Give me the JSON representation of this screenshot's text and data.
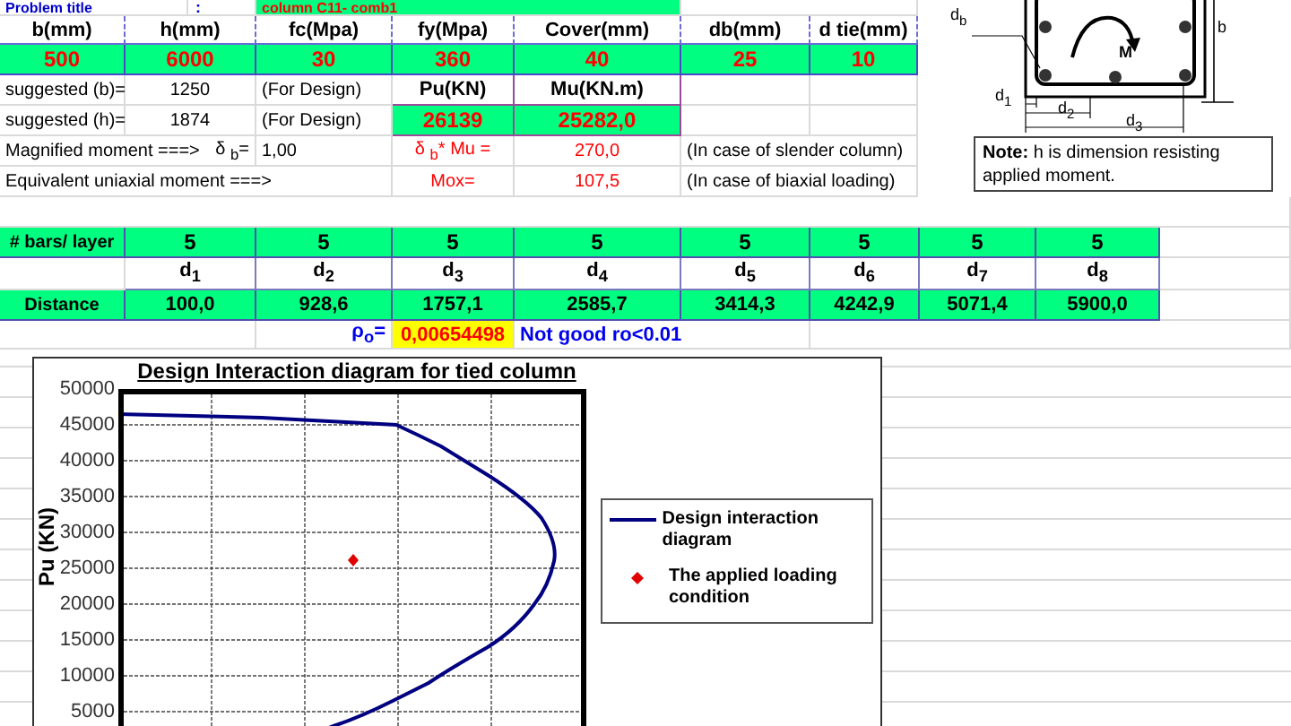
{
  "problem_title": {
    "label": "Problem title",
    "separator": ":",
    "value": "column C11- comb1"
  },
  "inputs": [
    {
      "label": "b(mm)",
      "value": "500"
    },
    {
      "label": "h(mm)",
      "value": "6000"
    },
    {
      "label": "fc(Mpa)",
      "value": "30"
    },
    {
      "label": "fy(Mpa)",
      "value": "360"
    },
    {
      "label": "Cover(mm)",
      "value": "40"
    },
    {
      "label": "db(mm)",
      "value": "25"
    },
    {
      "label": "d tie(mm)",
      "value": "10"
    }
  ],
  "suggested": [
    {
      "label": "suggested (b)=",
      "value": "1250",
      "note": "(For Design)"
    },
    {
      "label": "suggested (h)=",
      "value": "1874",
      "note": "(For Design)"
    }
  ],
  "loads": [
    {
      "label": "Pu(KN)",
      "value": "26139"
    },
    {
      "label": "Mu(KN.m)",
      "value": "25282,0"
    }
  ],
  "magnified": {
    "label": "Magnified moment ===>",
    "factor_label": "δ $_{b}$=",
    "factor": "1,00",
    "result_label": "δ $_{b}$* Mu =",
    "result": "270,0",
    "remark": "(In case of slender column)"
  },
  "equivalent": {
    "label": "Equivalent uniaxial moment ===>",
    "result_label": "Mox=",
    "result": "107,5",
    "remark": "(In case of biaxial loading)"
  },
  "section_drawing": {
    "labels": [
      "d$_{b}$",
      "b",
      "M",
      "d$_{1}$",
      "d$_{2}$",
      "d$_{3}$"
    ]
  },
  "note": "**Note:** h  is dimension resisting applied moment.",
  "layers": {
    "bars_label": "# bars/ layer",
    "distance_label": "Distance",
    "columns": [
      {
        "bars": "5",
        "name": "d$_{1}$",
        "distance": "100,0"
      },
      {
        "bars": "5",
        "name": "d$_{2}$",
        "distance": "928,6"
      },
      {
        "bars": "5",
        "name": "d$_{3}$",
        "distance": "1757,1"
      },
      {
        "bars": "5",
        "name": "d$_{4}$",
        "distance": "2585,7"
      },
      {
        "bars": "5",
        "name": "d$_{5}$",
        "distance": "3414,3"
      },
      {
        "bars": "5",
        "name": "d$_{6}$",
        "distance": "4242,9"
      },
      {
        "bars": "5",
        "name": "d$_{7}$",
        "distance": "5071,4"
      },
      {
        "bars": "5",
        "name": "d$_{8}$",
        "distance": "5900,0"
      }
    ]
  },
  "ratio": {
    "label": "ρ$_{o}$=",
    "value": "0,00654498",
    "status": "Not good ro<0.01"
  },
  "chart": {
    "title": "Design Interaction diagram for tied column",
    "ylabel": "Pu (KN)",
    "yticks": [
      "50000",
      "45000",
      "40000",
      "35000",
      "30000",
      "25000",
      "20000",
      "15000",
      "10000",
      "5000"
    ],
    "legend": [
      {
        "kind": "line",
        "label": "Design  interaction diagram"
      },
      {
        "kind": "point",
        "label": "The applied loading condition"
      }
    ]
  }
}
